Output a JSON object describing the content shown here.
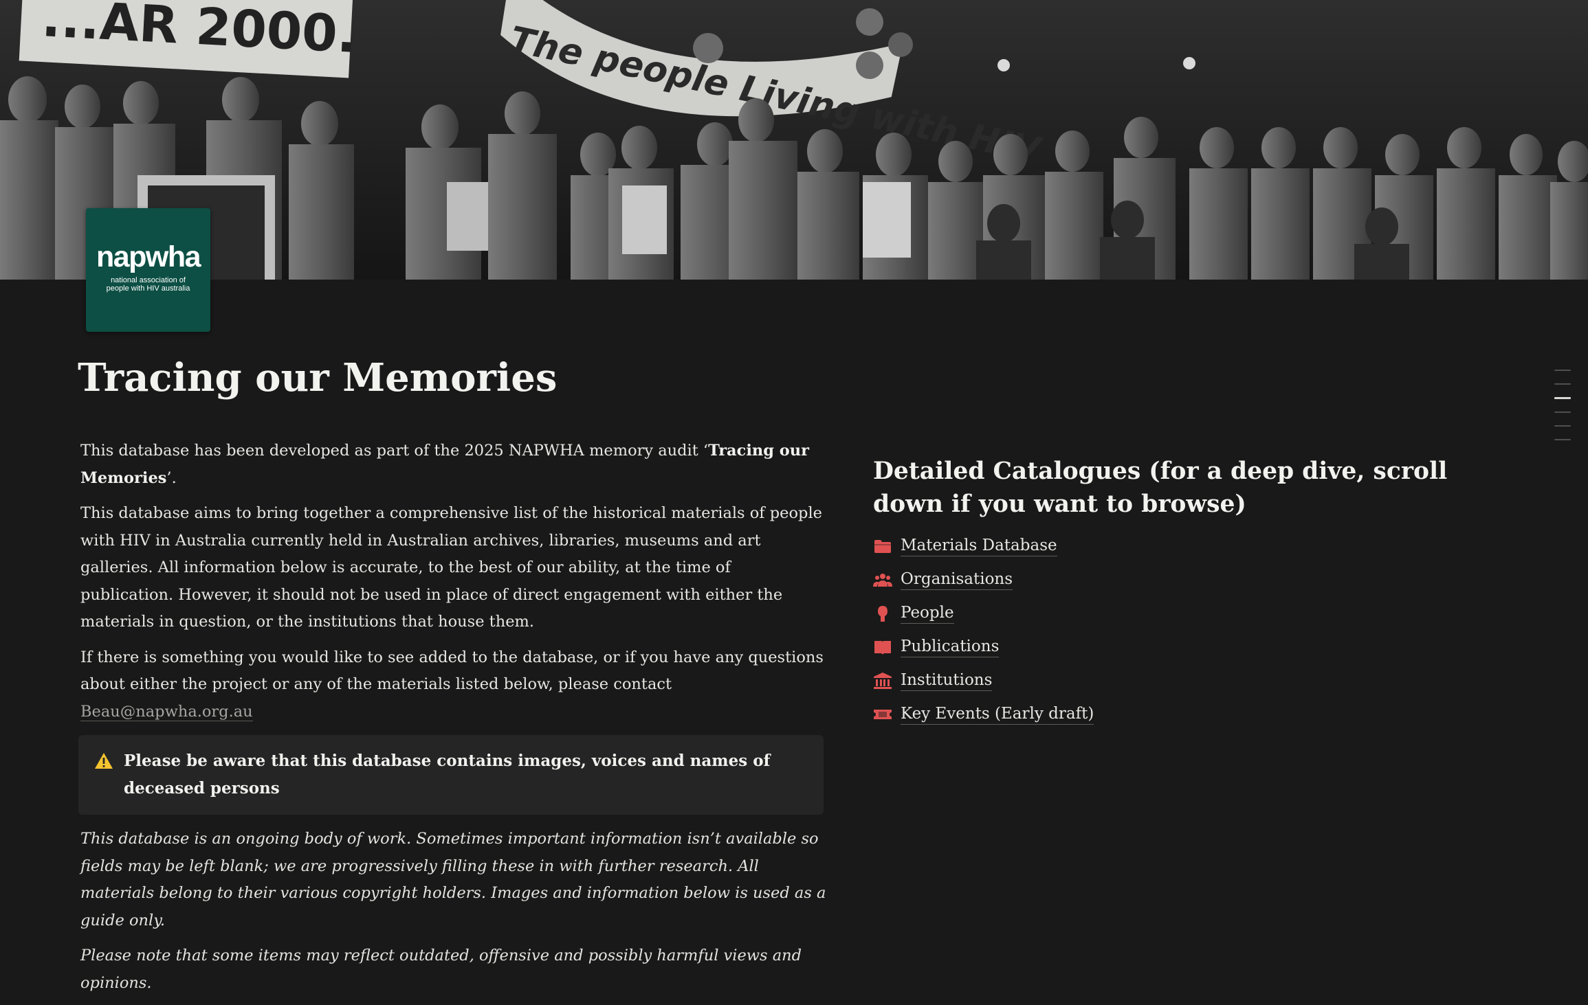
{
  "cover": {
    "banner_left_text": "...AR 2000.",
    "banner_right_text": "The people Living with HIV"
  },
  "logo": {
    "wordmark": "napwha",
    "tagline_line1": "national association of",
    "tagline_line2": "people with HIV australia",
    "color": "#0d4f44"
  },
  "page": {
    "title": "Tracing our Memories"
  },
  "intro": {
    "lead": "This database has been developed as part of the 2025 NAPWHA memory audit ‘",
    "lead_bold": "Tracing our Memories",
    "lead_end": "’.",
    "paragraph2": "This database aims to bring together a comprehensive list of the historical materials of people with HIV in Australia currently held in Australian archives, libraries, museums and art galleries. All information below is accurate, to the best of our ability, at the time of publication. However, it should not be used in place of direct engagement with either the materials in question, or the institutions that house them.",
    "paragraph3": "If there is something you would like to see added to the database, or if you have any questions about either the project or any of the materials listed below, please contact ",
    "email": "Beau@napwha.org.au"
  },
  "callout": {
    "icon": "warning-icon",
    "text": "Please be aware that this database contains images, voices and names of deceased persons",
    "icon_color": "#f4c430"
  },
  "notes": {
    "note1": "This database is an ongoing body of work. Sometimes important information isn’t available so fields may be left blank; we are progressively filling these in with further research. All materials belong to their various copyright holders. Images and information below is used as a guide only.",
    "note2": "Please note that some items may reflect outdated, offensive and possibly harmful views and opinions."
  },
  "catalogues": {
    "heading": "Detailed Catalogues (for a deep dive, scroll down if you want to browse)",
    "accent_color": "#e05252",
    "items": [
      {
        "label": "Materials Database",
        "icon": "folder-icon"
      },
      {
        "label": "Organisations",
        "icon": "group-icon"
      },
      {
        "label": "People",
        "icon": "person-icon"
      },
      {
        "label": "Publications",
        "icon": "book-icon"
      },
      {
        "label": "Institutions",
        "icon": "institution-icon"
      },
      {
        "label": "Key Events (Early draft)",
        "icon": "ticket-icon"
      }
    ]
  }
}
